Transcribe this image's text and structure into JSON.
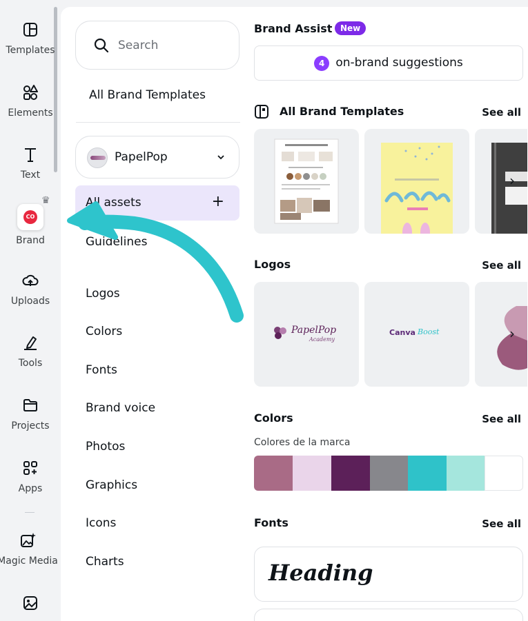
{
  "rail": {
    "items": [
      {
        "label": "Templates",
        "icon": "templates-icon"
      },
      {
        "label": "Elements",
        "icon": "elements-icon"
      },
      {
        "label": "Text",
        "icon": "text-icon"
      },
      {
        "label": "Brand",
        "icon": "brand-icon",
        "badge": "CO",
        "premium_icon": "crown-icon"
      },
      {
        "label": "Uploads",
        "icon": "upload-cloud-icon"
      },
      {
        "label": "Tools",
        "icon": "pen-tool-icon"
      },
      {
        "label": "Projects",
        "icon": "folder-icon"
      },
      {
        "label": "Apps",
        "icon": "apps-grid-icon"
      },
      {
        "label": "Magic Media",
        "icon": "magic-media-icon"
      },
      {
        "label": "",
        "icon": "image-icon"
      }
    ]
  },
  "panel": {
    "search_placeholder": "Search",
    "all_brand_templates": "All Brand Templates",
    "brand_kit": {
      "name": "PapelPop"
    },
    "all_assets": "All assets",
    "nav": [
      "Guidelines",
      "Logos",
      "Colors",
      "Fonts",
      "Brand voice",
      "Photos",
      "Graphics",
      "Icons",
      "Charts"
    ]
  },
  "main": {
    "brand_assist": {
      "title": "Brand Assist",
      "badge": "New",
      "suggestions_count": "4",
      "suggestions_label": "on-brand suggestions"
    },
    "templates": {
      "title": "All Brand Templates",
      "see_all": "See all"
    },
    "logos": {
      "title": "Logos",
      "see_all": "See all",
      "logo1_text": "PapelPop",
      "logo1_sub": "Academy",
      "logo2_text": "Canva",
      "logo2_accent": "Boost"
    },
    "colors": {
      "title": "Colors",
      "see_all": "See all",
      "palette_name": "Colores de la marca",
      "swatches": [
        "#a96b86",
        "#ead5ea",
        "#5c2059",
        "#87878c",
        "#2fc2c9",
        "#a5e6dd",
        "#ffffff"
      ]
    },
    "fonts": {
      "title": "Fonts",
      "see_all": "See all",
      "heading_sample": "Heading"
    }
  },
  "colors": {
    "accent": "#7d2ae8",
    "annotation_arrow": "#2ec4cc",
    "selected_bg": "#ebe6fb"
  }
}
